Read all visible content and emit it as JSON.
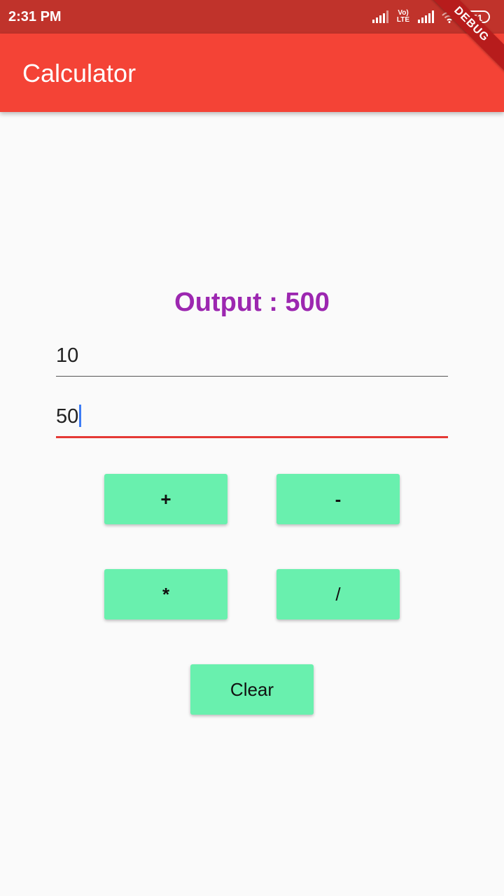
{
  "status_bar": {
    "time": "2:31 PM",
    "network_label": "Vo) LTE",
    "battery": "51",
    "debug_banner": "DEBUG"
  },
  "app_bar": {
    "title": "Calculator"
  },
  "main": {
    "output_text": "Output : 500",
    "input_first": "10",
    "input_second": "50",
    "buttons": {
      "add": "+",
      "subtract": "-",
      "multiply": "*",
      "divide": "/",
      "clear": "Clear"
    }
  },
  "colors": {
    "status_bar": "#c0332b",
    "app_bar": "#f44336",
    "output": "#9c27b0",
    "button": "#69f0ae",
    "focused_underline": "#e53935",
    "cursor": "#3d7cf5"
  }
}
